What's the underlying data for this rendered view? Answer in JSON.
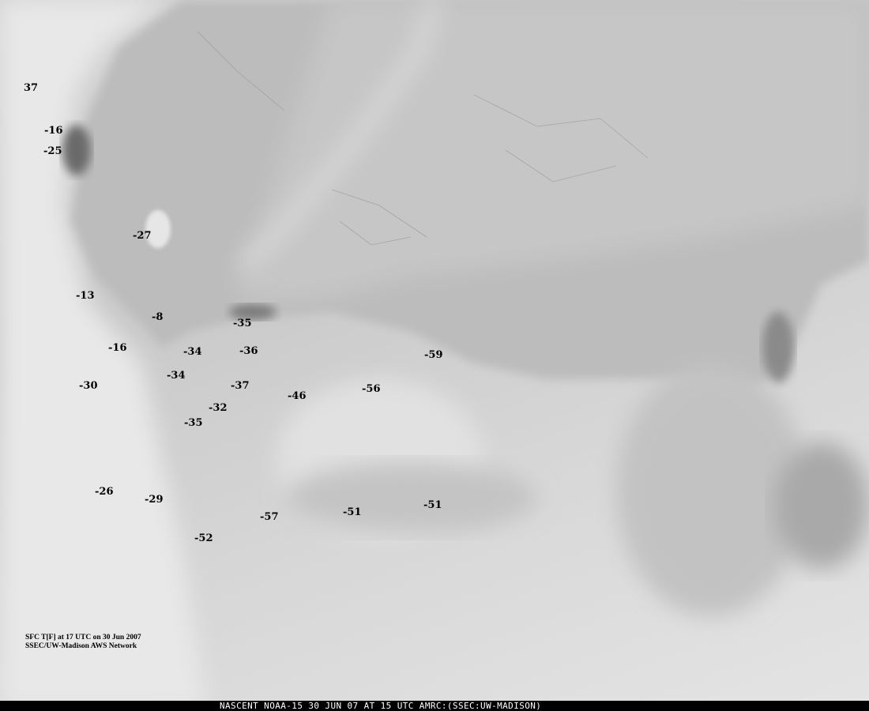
{
  "labels": [
    "37",
    "-16",
    "-25",
    "-27",
    "-13",
    "-8",
    "-35",
    "-16",
    "-34",
    "-36",
    "-34",
    "-30",
    "-37",
    "-46",
    "-56",
    "-59",
    "-32",
    "-35",
    "-26",
    "-29",
    "-57",
    "-51",
    "-51",
    "-52"
  ],
  "legend": {
    "line1": "SFC T[F] at 17 UTC on 30 Jun 2007",
    "line2": "SSEC/UW-Madison AWS Network"
  },
  "banner": "NASCENT NOAA-15 30 JUN 07 AT 15 UTC AMRC:(SSEC:UW-MADISON)"
}
